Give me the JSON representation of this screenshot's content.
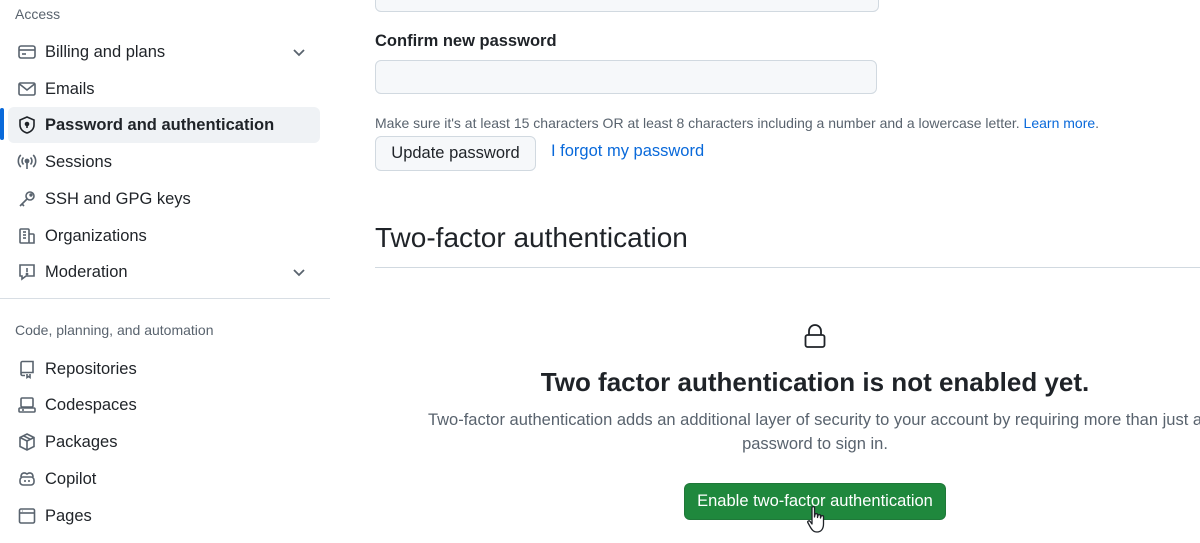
{
  "sidebar": {
    "access_title": "Access",
    "access_items": [
      {
        "label": "Billing and plans",
        "icon": "credit-card-icon",
        "expandable": true
      },
      {
        "label": "Emails",
        "icon": "mail-icon"
      },
      {
        "label": "Password and authentication",
        "icon": "shield-lock-icon",
        "active": true
      },
      {
        "label": "Sessions",
        "icon": "broadcast-icon"
      },
      {
        "label": "SSH and GPG keys",
        "icon": "key-icon"
      },
      {
        "label": "Organizations",
        "icon": "organization-icon"
      },
      {
        "label": "Moderation",
        "icon": "report-icon",
        "expandable": true
      }
    ],
    "code_title": "Code, planning, and automation",
    "code_items": [
      {
        "label": "Repositories",
        "icon": "repo-icon"
      },
      {
        "label": "Codespaces",
        "icon": "codespaces-icon"
      },
      {
        "label": "Packages",
        "icon": "package-icon"
      },
      {
        "label": "Copilot",
        "icon": "copilot-icon"
      },
      {
        "label": "Pages",
        "icon": "browser-icon"
      }
    ]
  },
  "password_form": {
    "confirm_label": "Confirm new password",
    "confirm_value": "",
    "hint": "Make sure it's at least 15 characters OR at least 8 characters including a number and a lowercase letter.",
    "learn_more": "Learn more",
    "update_button": "Update password",
    "forgot_link": "I forgot my password"
  },
  "two_factor": {
    "heading": "Two-factor authentication",
    "blank_title": "Two factor authentication is not enabled yet.",
    "blank_description": "Two-factor authentication adds an additional layer of security to your account by requiring more than just a password to sign in.",
    "enable_button": "Enable two-factor authentication"
  },
  "colors": {
    "accent": "#0969da",
    "primary_button": "#1f883d",
    "muted_text": "#59636e"
  }
}
